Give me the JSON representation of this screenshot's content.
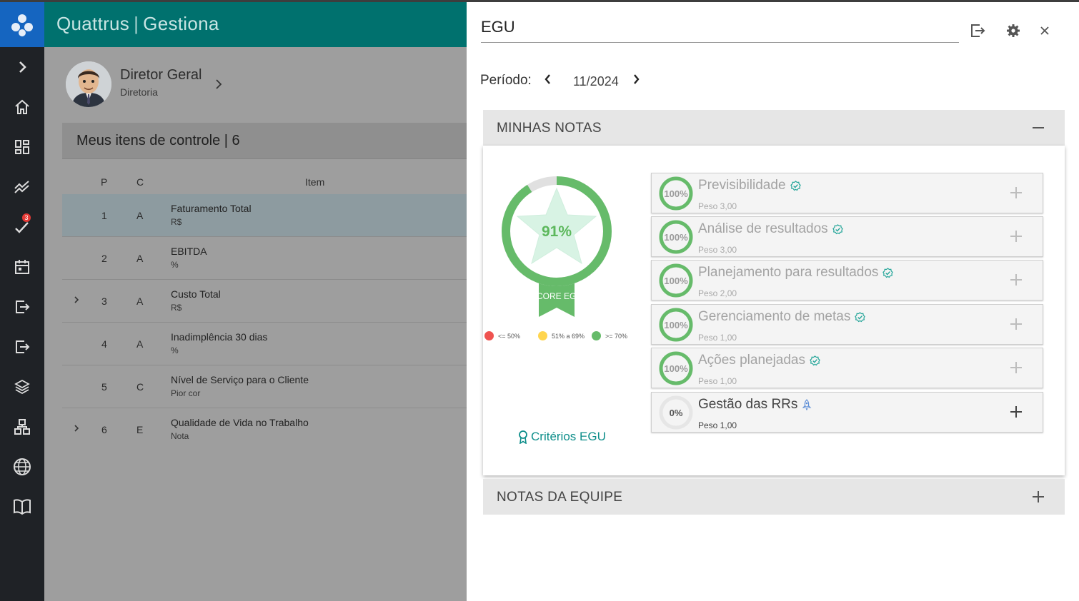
{
  "app": {
    "brand": "Quattrus",
    "product": "Gestiona"
  },
  "rail": {
    "badge_count": "3"
  },
  "user": {
    "name": "Diretor Geral",
    "role": "Diretoria"
  },
  "control": {
    "title": "Meus itens de controle | 6",
    "columns": {
      "p": "P",
      "c": "C",
      "item": "Item"
    },
    "rows": [
      {
        "p": "1",
        "c": "A",
        "name": "Faturamento Total",
        "unit": "R$"
      },
      {
        "p": "2",
        "c": "A",
        "name": "EBITDA",
        "unit": "%"
      },
      {
        "p": "3",
        "c": "A",
        "name": "Custo Total",
        "unit": "R$"
      },
      {
        "p": "4",
        "c": "A",
        "name": "Inadimplência 30 dias",
        "unit": "%"
      },
      {
        "p": "5",
        "c": "C",
        "name": "Nível de Serviço para o Cliente",
        "unit": "Pior cor"
      },
      {
        "p": "6",
        "c": "E",
        "name": "Qualidade de Vida no Trabalho",
        "unit": "Nota"
      }
    ]
  },
  "panel": {
    "title": "EGU",
    "period_label": "Período:",
    "period_value": "11/2024",
    "my_notes": "MINHAS NOTAS",
    "team_notes": "NOTAS DA EQUIPE",
    "score": {
      "value": "91%",
      "fraction": 0.91,
      "label": "SCORE EGU"
    },
    "legend": [
      {
        "label": "<= 50%",
        "color": "#ef5350"
      },
      {
        "label": "51% a 69%",
        "color": "#ffd54f"
      },
      {
        "label": ">= 70%",
        "color": "#66bb6a"
      }
    ],
    "criteria_link": "Critérios EGU",
    "cards": [
      {
        "name": "Previsibilidade",
        "weight": "Peso 3,00",
        "pct": "100%",
        "fraction": 1
      },
      {
        "name": "Análise de resultados",
        "weight": "Peso 3,00",
        "pct": "100%",
        "fraction": 1
      },
      {
        "name": "Planejamento para resultados",
        "weight": "Peso 2,00",
        "pct": "100%",
        "fraction": 1
      },
      {
        "name": "Gerenciamento de metas",
        "weight": "Peso 1,00",
        "pct": "100%",
        "fraction": 1
      },
      {
        "name": "Ações planejadas",
        "weight": "Peso 1,00",
        "pct": "100%",
        "fraction": 1
      },
      {
        "name": "Gestão das RRs",
        "weight": "Peso 1,00",
        "pct": "0%",
        "fraction": 0
      }
    ]
  }
}
